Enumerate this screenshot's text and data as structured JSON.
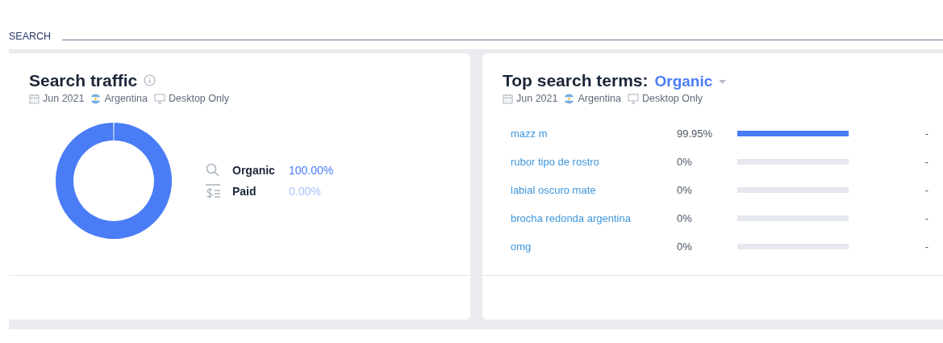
{
  "section_label": "SEARCH",
  "search_traffic": {
    "title": "Search traffic",
    "meta": {
      "date": "Jun 2021",
      "country": "Argentina",
      "device": "Desktop Only"
    },
    "legend": [
      {
        "kind": "organic",
        "label": "Organic",
        "value": "100.00%"
      },
      {
        "kind": "paid",
        "label": "Paid",
        "value": "0.00%"
      }
    ]
  },
  "top_search_terms": {
    "title": "Top search terms:",
    "filter": "Organic",
    "meta": {
      "date": "Jun 2021",
      "country": "Argentina",
      "device": "Desktop Only"
    },
    "rows": [
      {
        "term": "mazz m",
        "share": "99.95%",
        "level": 0.9995,
        "change": "-"
      },
      {
        "term": "rubor tipo de rostro",
        "share": "0%",
        "level": 0,
        "change": "-"
      },
      {
        "term": "labial oscuro mate",
        "share": "0%",
        "level": 0,
        "change": "-"
      },
      {
        "term": "brocha redonda argentina",
        "share": "0%",
        "level": 0,
        "change": "-"
      },
      {
        "term": "omg",
        "share": "0%",
        "level": 0,
        "change": "-"
      }
    ]
  }
}
